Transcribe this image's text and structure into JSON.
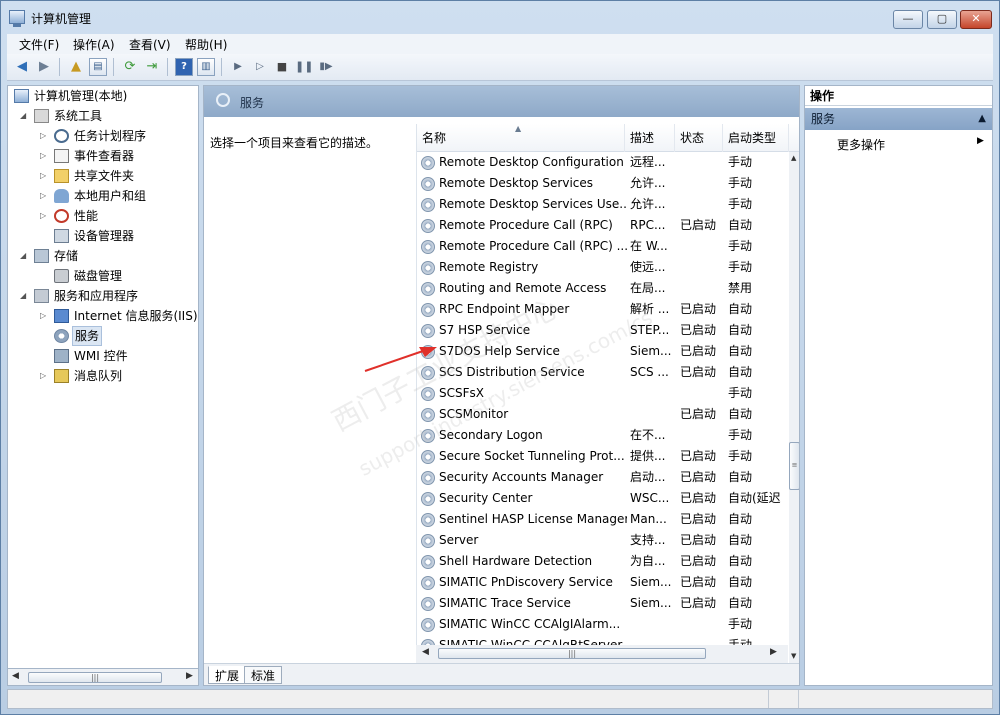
{
  "window": {
    "title": "计算机管理",
    "controls": {
      "minimize": "—",
      "maximize": "▢",
      "close": "✕"
    }
  },
  "menu": [
    "文件(F)",
    "操作(A)",
    "查看(V)",
    "帮助(H)"
  ],
  "toolbar": {
    "icons": [
      "back-icon",
      "forward-icon",
      "up-icon",
      "show-tree-icon",
      "refresh-icon",
      "export-icon",
      "help-icon",
      "properties-icon",
      "start-icon",
      "start-alt-icon",
      "stop-icon",
      "pause-icon",
      "restart-icon"
    ]
  },
  "tree": {
    "root": "计算机管理(本地)",
    "items": [
      {
        "label": "系统工具",
        "level": 1,
        "expanded": true,
        "icon": "tools-icon"
      },
      {
        "label": "任务计划程序",
        "level": 2,
        "expanded": false,
        "icon": "clock-icon"
      },
      {
        "label": "事件查看器",
        "level": 2,
        "expanded": false,
        "icon": "event-icon"
      },
      {
        "label": "共享文件夹",
        "level": 2,
        "expanded": false,
        "icon": "folder-icon"
      },
      {
        "label": "本地用户和组",
        "level": 2,
        "expanded": false,
        "icon": "users-icon"
      },
      {
        "label": "性能",
        "level": 2,
        "expanded": false,
        "icon": "performance-icon"
      },
      {
        "label": "设备管理器",
        "level": 2,
        "expanded": null,
        "icon": "device-icon"
      },
      {
        "label": "存储",
        "level": 1,
        "expanded": true,
        "icon": "storage-icon"
      },
      {
        "label": "磁盘管理",
        "level": 2,
        "expanded": null,
        "icon": "disk-icon"
      },
      {
        "label": "服务和应用程序",
        "level": 1,
        "expanded": true,
        "icon": "services-apps-icon"
      },
      {
        "label": "Internet 信息服务(IIS)管",
        "level": 2,
        "expanded": false,
        "icon": "iis-icon"
      },
      {
        "label": "服务",
        "level": 2,
        "expanded": null,
        "icon": "gear-icon",
        "selected": true
      },
      {
        "label": "WMI 控件",
        "level": 2,
        "expanded": null,
        "icon": "wmi-icon"
      },
      {
        "label": "消息队列",
        "level": 2,
        "expanded": false,
        "icon": "message-queue-icon"
      }
    ]
  },
  "middle": {
    "header": "服务",
    "description": "选择一个项目来查看它的描述。",
    "columns": {
      "name": "名称",
      "desc": "描述",
      "status": "状态",
      "startup": "启动类型"
    },
    "rows": [
      {
        "name": "Remote Desktop Configuration",
        "desc": "远程...",
        "status": "",
        "startup": "手动"
      },
      {
        "name": "Remote Desktop Services",
        "desc": "允许...",
        "status": "",
        "startup": "手动"
      },
      {
        "name": "Remote Desktop Services Use...",
        "desc": "允许...",
        "status": "",
        "startup": "手动"
      },
      {
        "name": "Remote Procedure Call (RPC)",
        "desc": "RPC...",
        "status": "已启动",
        "startup": "自动"
      },
      {
        "name": "Remote Procedure Call (RPC) ...",
        "desc": "在 W...",
        "status": "",
        "startup": "手动"
      },
      {
        "name": "Remote Registry",
        "desc": "使远...",
        "status": "",
        "startup": "手动"
      },
      {
        "name": "Routing and Remote Access",
        "desc": "在局...",
        "status": "",
        "startup": "禁用"
      },
      {
        "name": "RPC Endpoint Mapper",
        "desc": "解析 ...",
        "status": "已启动",
        "startup": "自动"
      },
      {
        "name": "S7 HSP Service",
        "desc": "STEP...",
        "status": "已启动",
        "startup": "自动"
      },
      {
        "name": "S7DOS Help Service",
        "desc": "Siem...",
        "status": "已启动",
        "startup": "自动"
      },
      {
        "name": "SCS Distribution Service",
        "desc": "SCS ...",
        "status": "已启动",
        "startup": "自动"
      },
      {
        "name": "SCSFsX",
        "desc": "",
        "status": "",
        "startup": "手动"
      },
      {
        "name": "SCSMonitor",
        "desc": "",
        "status": "已启动",
        "startup": "自动"
      },
      {
        "name": "Secondary Logon",
        "desc": "在不...",
        "status": "",
        "startup": "手动"
      },
      {
        "name": "Secure Socket Tunneling Prot...",
        "desc": "提供...",
        "status": "已启动",
        "startup": "手动"
      },
      {
        "name": "Security Accounts Manager",
        "desc": "启动...",
        "status": "已启动",
        "startup": "自动"
      },
      {
        "name": "Security Center",
        "desc": "WSC...",
        "status": "已启动",
        "startup": "自动(延迟"
      },
      {
        "name": "Sentinel HASP License Manager",
        "desc": "Man...",
        "status": "已启动",
        "startup": "自动"
      },
      {
        "name": "Server",
        "desc": "支持...",
        "status": "已启动",
        "startup": "自动"
      },
      {
        "name": "Shell Hardware Detection",
        "desc": "为自...",
        "status": "已启动",
        "startup": "自动"
      },
      {
        "name": "SIMATIC PnDiscovery Service",
        "desc": "Siem...",
        "status": "已启动",
        "startup": "自动"
      },
      {
        "name": "SIMATIC Trace Service",
        "desc": "Siem...",
        "status": "已启动",
        "startup": "自动"
      },
      {
        "name": "SIMATIC WinCC CCAlgIAlarm...",
        "desc": "",
        "status": "",
        "startup": "手动"
      },
      {
        "name": "SIMATIC WinCC CCAlgRtServer",
        "desc": "",
        "status": "",
        "startup": "手动"
      }
    ],
    "tabs": [
      "扩展",
      "标准"
    ]
  },
  "actions": {
    "title": "操作",
    "section": "服务",
    "more": "更多操作"
  },
  "watermark": {
    "line1": "西门子工业支持中心",
    "line2": "support.industry.siemens.com/cs"
  },
  "colors": {
    "annotation_arrow": "#e0302a",
    "selection": "#dbe6f3"
  }
}
